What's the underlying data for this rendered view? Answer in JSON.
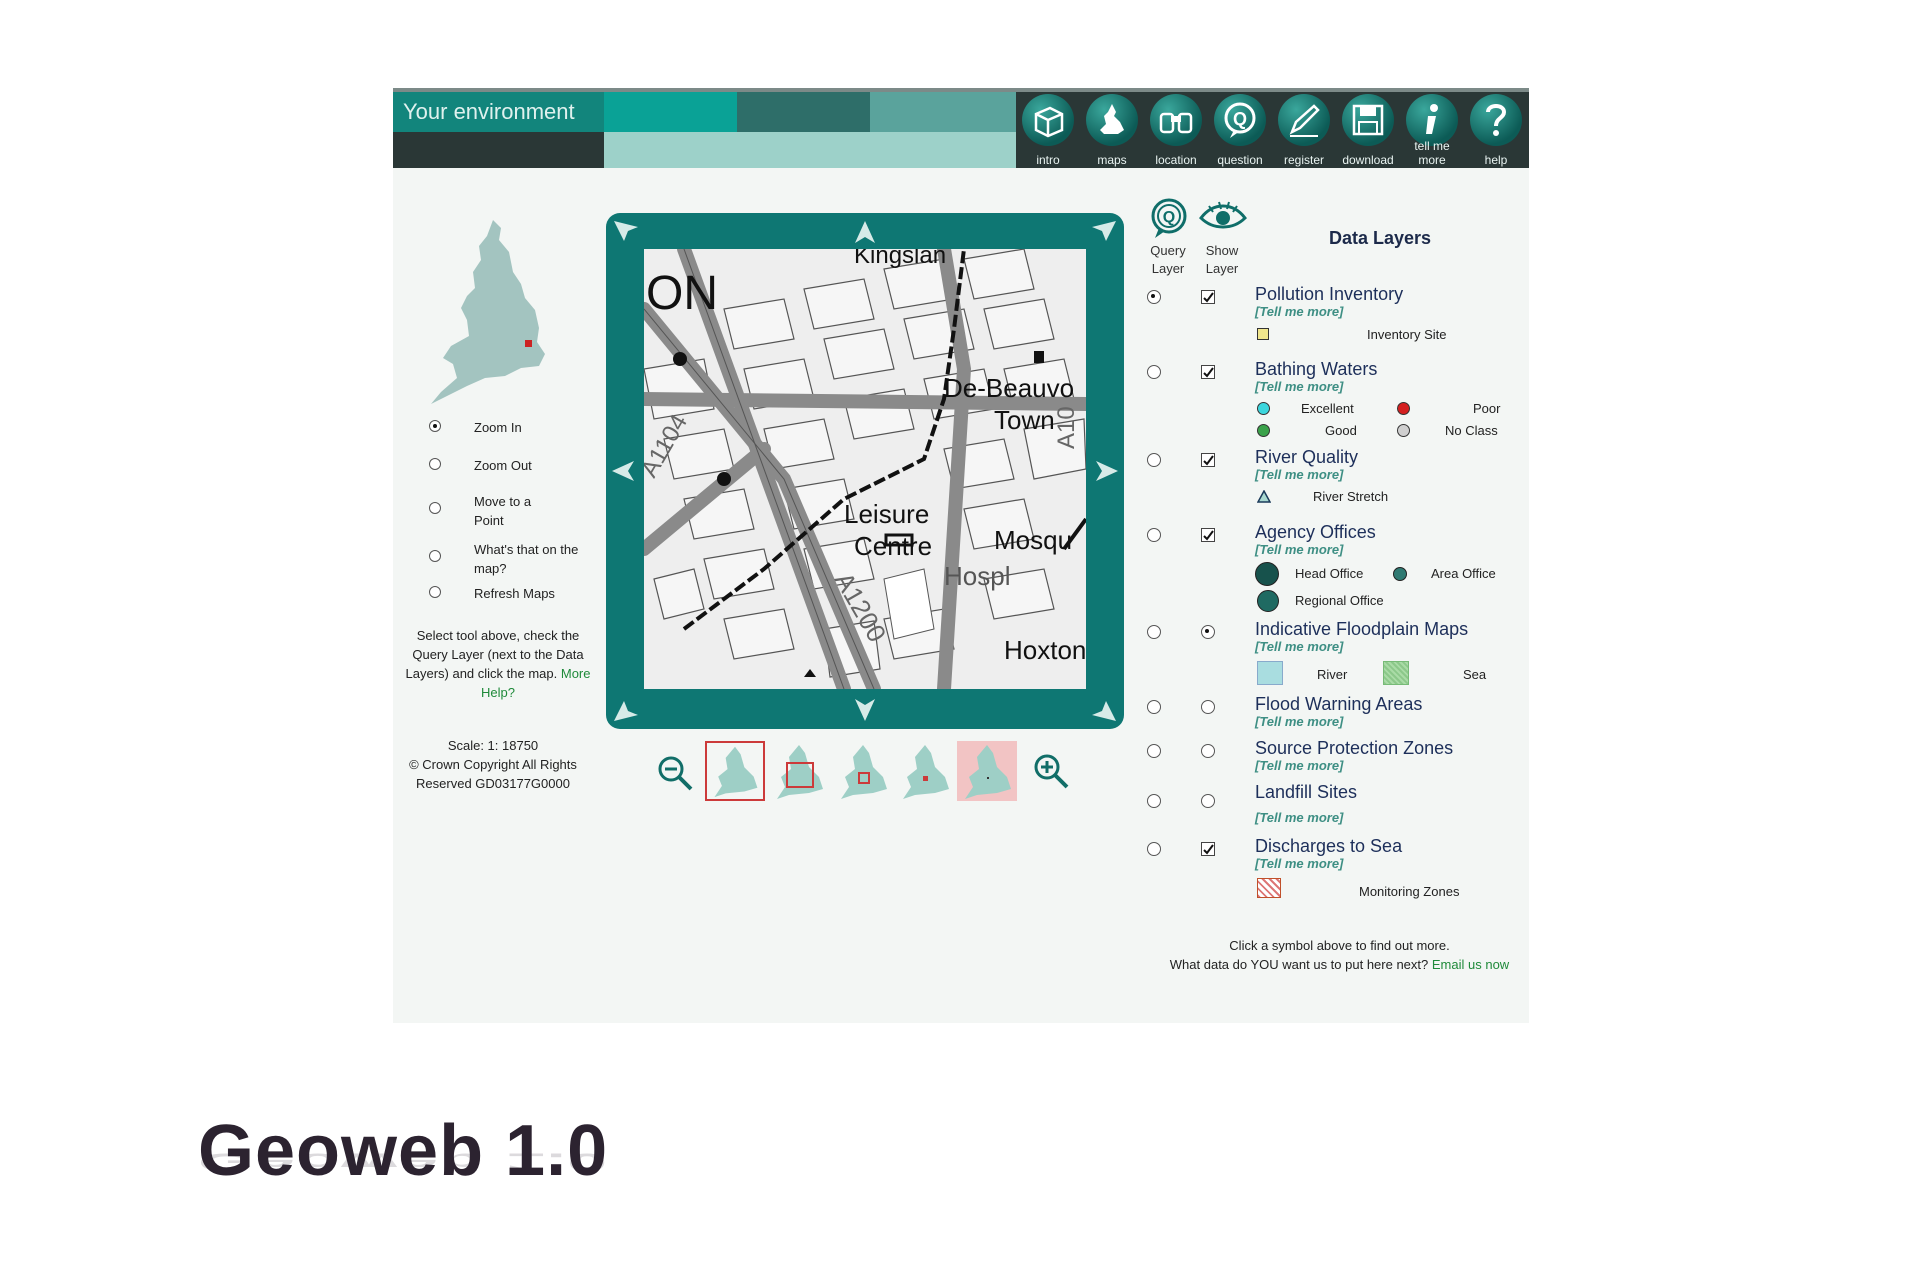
{
  "header": {
    "title": "Your environment",
    "nav": [
      {
        "label": "intro",
        "icon": "intro-box-icon"
      },
      {
        "label": "maps",
        "icon": "maps-icon"
      },
      {
        "label": "location",
        "icon": "binoculars-icon"
      },
      {
        "label": "question",
        "icon": "question-q-icon"
      },
      {
        "label": "register",
        "icon": "pen-icon"
      },
      {
        "label": "download",
        "icon": "disk-icon"
      },
      {
        "label": "tell me more",
        "icon": "info-icon"
      },
      {
        "label": "help",
        "icon": "help-icon"
      }
    ],
    "colors": {
      "accent": "#12857c",
      "dark": "#2a3736",
      "light": "#9dd1c9"
    }
  },
  "tools": {
    "items": [
      {
        "label": "Zoom In",
        "selected": true
      },
      {
        "label": "Zoom Out",
        "selected": false
      },
      {
        "label": "Move to a Point",
        "selected": false
      },
      {
        "label": "What's that on the map?",
        "selected": false
      },
      {
        "label": "Refresh Maps",
        "selected": false
      }
    ],
    "help_text": "Select tool above, check the Query Layer (next to the Data Layers) and click the map.",
    "help_link": "More Help?",
    "scale": "Scale: 1: 18750",
    "copyright": "© Crown Copyright All Rights Reserved GD03177G0000"
  },
  "map": {
    "labels": [
      "ON",
      "De-Beauvo",
      "Town",
      "Leisure",
      "Centre",
      "Mosqu",
      "Hospl",
      "Hoxton",
      "A1200",
      "A1104",
      "Kingslan",
      "A10"
    ]
  },
  "layers": {
    "query_header": "Query Layer",
    "show_header": "Show Layer",
    "title": "Data Layers",
    "tell_more": "[Tell me more]",
    "items": [
      {
        "name": "Pollution Inventory",
        "query": true,
        "show": "checked"
      },
      {
        "name": "Bathing Waters",
        "query": false,
        "show": "checked"
      },
      {
        "name": "River Quality",
        "query": false,
        "show": "checked"
      },
      {
        "name": "Agency Offices",
        "query": false,
        "show": "checked"
      },
      {
        "name": "Indicative Floodplain Maps",
        "query": false,
        "show": "radio-on"
      },
      {
        "name": "Flood Warning Areas",
        "query": false,
        "show": "radio"
      },
      {
        "name": "Source Protection Zones",
        "query": false,
        "show": "radio"
      },
      {
        "name": "Landfill Sites",
        "query": false,
        "show": "radio"
      },
      {
        "name": "Discharges to Sea",
        "query": false,
        "show": "checked"
      }
    ],
    "legend": {
      "inventory_site": "Inventory Site",
      "excellent": "Excellent",
      "poor": "Poor",
      "good": "Good",
      "no_class": "No Class",
      "river_stretch": "River Stretch",
      "head_office": "Head Office",
      "area_office": "Area Office",
      "regional_office": "Regional Office",
      "river": "River",
      "sea": "Sea",
      "monitoring_zones": "Monitoring Zones"
    },
    "footer_line1": "Click a symbol above to find out more.",
    "footer_line2": "What data do YOU want us to put here next?",
    "footer_link": "Email us now"
  },
  "slide": {
    "title": "Geoweb 1.0"
  }
}
